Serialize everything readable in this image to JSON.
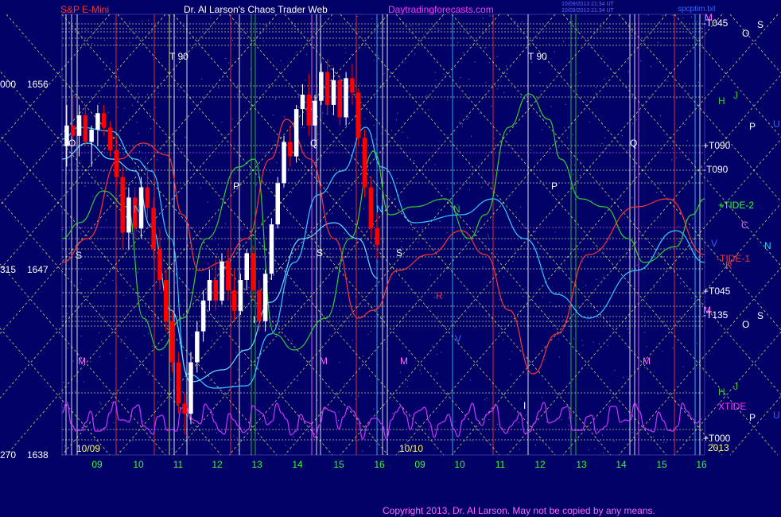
{
  "header": {
    "symbol": "S&P E-Mini",
    "title": "Dr. Al Larson's Chaos Trader Web",
    "site": "Daytradingforecasts.com",
    "stamp1": "10/09/2013 21:34 UT",
    "stamp2": "10/09/2013 21:34 UT",
    "file": "spcptim.txt"
  },
  "footer": {
    "copyright": "Copyright 2013, Dr. Al Larson. May not be copied by any means."
  },
  "colors": {
    "background": "#000066",
    "price_up": "#ffffff",
    "price_down": "#ff0000",
    "cyan": "#33ccff",
    "red": "#ff3333",
    "green": "#33cc33",
    "magenta": "#cc33ff",
    "yellow": "#ffff66"
  },
  "chart_data": {
    "type": "candlestick",
    "y_labels_left": [
      {
        "price": 1656,
        "label": "1656",
        "prefix": "000"
      },
      {
        "price": 1647,
        "label": "1647",
        "prefix": "315"
      },
      {
        "price": 1638,
        "label": "1638",
        "prefix": "270"
      }
    ],
    "ylim": [
      1638,
      1659.4
    ],
    "date_labels": [
      "10/09",
      "10/10"
    ],
    "year_label": "2013",
    "x_ticks": [
      "09",
      "10",
      "11",
      "12",
      "13",
      "14",
      "15",
      "16",
      "09",
      "10",
      "11",
      "12",
      "13",
      "14",
      "15",
      "16"
    ],
    "right_labels": [
      {
        "text": "-T045",
        "color": "#ffffff"
      },
      {
        "text": "+T090",
        "color": "#ffffff"
      },
      {
        "text": "-T090",
        "color": "#ffffff"
      },
      {
        "text": "+TIDE-2",
        "color": "#33ff33"
      },
      {
        "text": "-TIDE-1",
        "color": "#ff3333"
      },
      {
        "text": "+T045",
        "color": "#ffffff"
      },
      {
        "text": "-T135",
        "color": "#ffffff"
      },
      {
        "text": "XTIDE",
        "color": "#ff33ff"
      },
      {
        "text": "+T000",
        "color": "#ffffff"
      }
    ],
    "planet_labels_right": [
      "M",
      "O",
      "S",
      "H",
      "J",
      "P",
      "U",
      "C",
      "V",
      "N",
      "R",
      "M",
      "O",
      "S",
      "H",
      "J",
      "P",
      "U"
    ],
    "markers": [
      "T 90",
      "T 90",
      "O",
      "Q",
      "Q",
      "P",
      "P",
      "N",
      "N",
      "N",
      "M",
      "M",
      "M",
      "M",
      "S",
      "S",
      "S",
      "R",
      "V",
      "I",
      "I"
    ],
    "series": [
      {
        "name": "price",
        "color": "#ffffff",
        "bars": [
          [
            1653,
            1655,
            1652,
            1654
          ],
          [
            1654,
            1655.5,
            1653,
            1653.5
          ],
          [
            1653.5,
            1655,
            1652.5,
            1654.5
          ],
          [
            1654.5,
            1655,
            1653,
            1653.2
          ],
          [
            1653.2,
            1654,
            1652,
            1653.8
          ],
          [
            1653.8,
            1655,
            1653,
            1654.6
          ],
          [
            1654.6,
            1655,
            1653.5,
            1653.9
          ],
          [
            1653.9,
            1654.2,
            1652.5,
            1652.8
          ],
          [
            1652.8,
            1653.5,
            1651,
            1651.5
          ],
          [
            1651.5,
            1652,
            1648,
            1648.8
          ],
          [
            1648.8,
            1651,
            1648,
            1650.5
          ],
          [
            1650.5,
            1651,
            1648.5,
            1649
          ],
          [
            1649,
            1651.5,
            1648.5,
            1651
          ],
          [
            1651,
            1652,
            1649.5,
            1650
          ],
          [
            1650,
            1650.5,
            1647.5,
            1648
          ],
          [
            1648,
            1649,
            1646,
            1646.5
          ],
          [
            1646.5,
            1647,
            1644,
            1644.5
          ],
          [
            1644.5,
            1645,
            1642,
            1642.5
          ],
          [
            1642.5,
            1643,
            1640,
            1640.5
          ],
          [
            1640.5,
            1641,
            1639,
            1640
          ],
          [
            1640,
            1643,
            1639.5,
            1642.5
          ],
          [
            1642.5,
            1644.5,
            1642,
            1644
          ],
          [
            1644,
            1646,
            1643.5,
            1645.5
          ],
          [
            1645.5,
            1647,
            1645,
            1646.5
          ],
          [
            1646.5,
            1647.5,
            1645,
            1645.5
          ],
          [
            1645.5,
            1647.8,
            1645.3,
            1647.4
          ],
          [
            1647.4,
            1648,
            1645.5,
            1646
          ],
          [
            1646,
            1647,
            1644.5,
            1645
          ],
          [
            1645,
            1646.8,
            1644.8,
            1646.5
          ],
          [
            1646.5,
            1648,
            1646,
            1647.8
          ],
          [
            1647.8,
            1648.2,
            1645.5,
            1646
          ],
          [
            1646,
            1646.5,
            1644,
            1644.5
          ],
          [
            1644.5,
            1647,
            1644,
            1646.8
          ],
          [
            1646.8,
            1649.5,
            1646.5,
            1649.2
          ],
          [
            1649.2,
            1651.5,
            1649,
            1651.2
          ],
          [
            1651.2,
            1653.5,
            1651,
            1653.2
          ],
          [
            1653.2,
            1654,
            1652,
            1652.5
          ],
          [
            1652.5,
            1655,
            1652.2,
            1654.8
          ],
          [
            1654.8,
            1656,
            1654,
            1655.5
          ],
          [
            1655.5,
            1656.5,
            1653.5,
            1654
          ],
          [
            1654,
            1655.5,
            1653,
            1655.2
          ],
          [
            1655.2,
            1657,
            1655,
            1656.6
          ],
          [
            1656.6,
            1657.2,
            1654.5,
            1655
          ],
          [
            1655,
            1656.8,
            1654.5,
            1656.2
          ],
          [
            1656.2,
            1656.5,
            1654,
            1654.4
          ],
          [
            1654.4,
            1656.6,
            1654,
            1656.3
          ],
          [
            1656.3,
            1657,
            1655,
            1655.6
          ],
          [
            1655.6,
            1655.8,
            1653,
            1653.4
          ],
          [
            1653.4,
            1653.8,
            1650.5,
            1651
          ],
          [
            1651,
            1651.5,
            1648.5,
            1649
          ],
          [
            1649,
            1650,
            1647.5,
            1648.2
          ]
        ]
      }
    ]
  }
}
